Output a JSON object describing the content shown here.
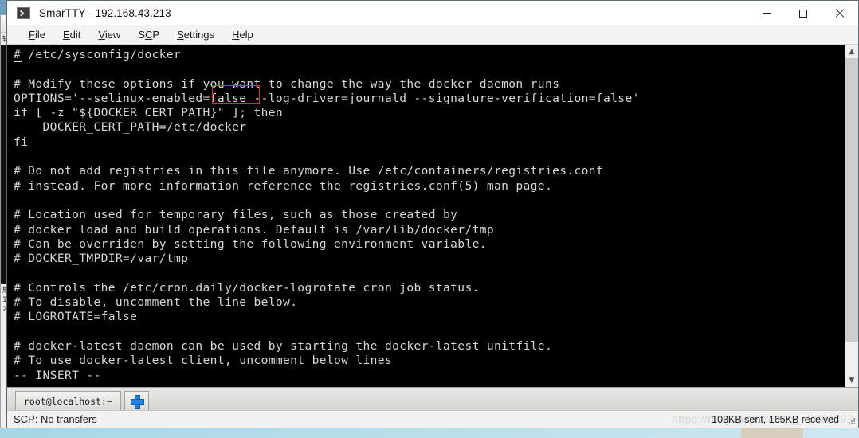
{
  "window": {
    "title": "SmarTTY - 192.168.43.213",
    "app_icon": "terminal-icon",
    "controls": {
      "minimize": "minimize-icon",
      "maximize": "maximize-icon",
      "close": "close-icon"
    }
  },
  "menubar": {
    "items": [
      {
        "label": "File",
        "accel": "F"
      },
      {
        "label": "Edit",
        "accel": "E"
      },
      {
        "label": "View",
        "accel": "V"
      },
      {
        "label": "SCP",
        "accel": "C"
      },
      {
        "label": "Settings",
        "accel": "S"
      },
      {
        "label": "Help",
        "accel": "H"
      }
    ]
  },
  "terminal": {
    "lines": [
      "# /etc/sysconfig/docker",
      "",
      "# Modify these options if you want to change the way the docker daemon runs",
      "OPTIONS='--selinux-enabled=false --log-driver=journald --signature-verification=false'",
      "if [ -z \"${DOCKER_CERT_PATH}\" ]; then",
      "    DOCKER_CERT_PATH=/etc/docker",
      "fi",
      "",
      "# Do not add registries in this file anymore. Use /etc/containers/registries.conf",
      "# instead. For more information reference the registries.conf(5) man page.",
      "",
      "# Location used for temporary files, such as those created by",
      "# docker load and build operations. Default is /var/lib/docker/tmp",
      "# Can be overriden by setting the following environment variable.",
      "# DOCKER_TMPDIR=/var/tmp",
      "",
      "# Controls the /etc/cron.daily/docker-logrotate cron job status.",
      "# To disable, uncomment the line below.",
      "# LOGROTATE=false",
      "",
      "# docker-latest daemon can be used by starting the docker-latest unitfile.",
      "# To use docker-latest client, uncomment below lines",
      "-- INSERT --"
    ],
    "annotation": {
      "name": "selinux-false-highlight",
      "target_text": "=false",
      "color": "#e0322c"
    },
    "cursor": {
      "style": "underline",
      "line": 1,
      "column": 1
    },
    "colors": {
      "background": "#000000",
      "foreground": "#d6d6d6"
    }
  },
  "scrollbar": {
    "up_arrow": "chevron-up-icon",
    "down_arrow": "chevron-down-icon"
  },
  "tabs": {
    "sessions": [
      {
        "label": "root@localhost:~",
        "active": true
      }
    ],
    "add_tab_icon": "plus-icon"
  },
  "statusbar": {
    "scp": "SCP: No transfers",
    "transfer": "103KB sent, 165KB received",
    "watermark": "https://blog.csdn.net/qq_43863792"
  }
}
